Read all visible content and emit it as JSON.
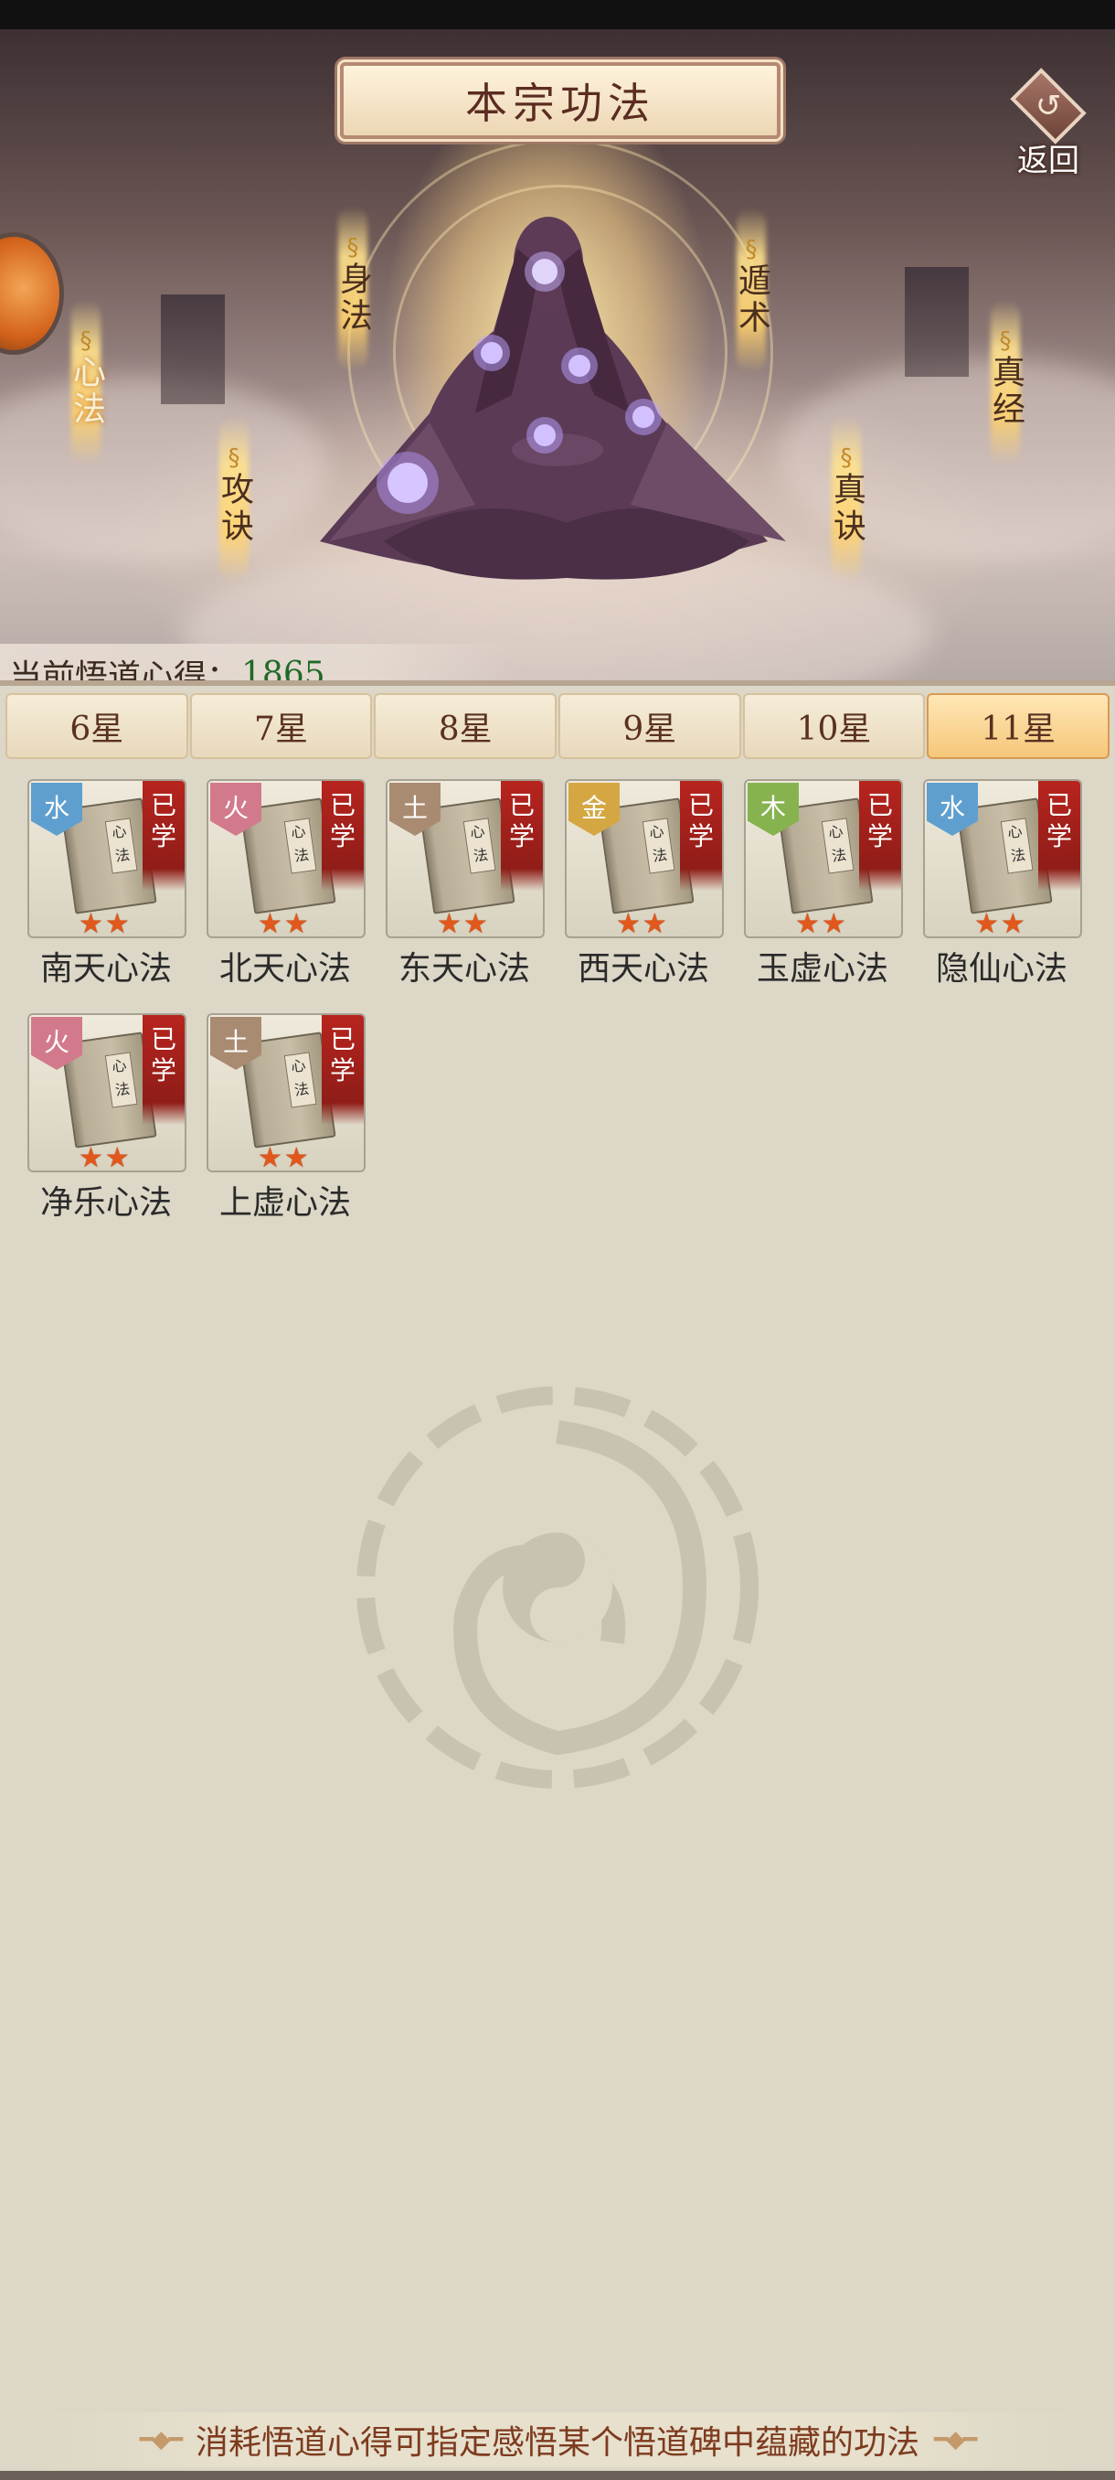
{
  "header": {
    "title": "本宗功法",
    "back_label": "返回"
  },
  "techniques": {
    "xinfa": "心法",
    "shenfa": "身法",
    "gongjue": "攻诀",
    "dunshu": "遁术",
    "zhenjue": "真诀",
    "zhenjing": "真经"
  },
  "wudao": {
    "label": "当前悟道心得：",
    "value": "1865"
  },
  "tabs": [
    {
      "label": "6星"
    },
    {
      "label": "7星"
    },
    {
      "label": "8星"
    },
    {
      "label": "9星"
    },
    {
      "label": "10星"
    },
    {
      "label": "11星"
    }
  ],
  "active_tab_index": 5,
  "book_glyph": "心法",
  "learned_text": [
    "已",
    "学"
  ],
  "items": [
    {
      "name": "南天心法",
      "element": "水",
      "element_color": "#5f9fcf",
      "stars": 2
    },
    {
      "name": "北天心法",
      "element": "火",
      "element_color": "#d27a8c",
      "stars": 2
    },
    {
      "name": "东天心法",
      "element": "土",
      "element_color": "#a98b72",
      "stars": 2
    },
    {
      "name": "西天心法",
      "element": "金",
      "element_color": "#d5a743",
      "stars": 2
    },
    {
      "name": "玉虚心法",
      "element": "木",
      "element_color": "#86b34f",
      "stars": 2
    },
    {
      "name": "隐仙心法",
      "element": "水",
      "element_color": "#5f9fcf",
      "stars": 2
    },
    {
      "name": "净乐心法",
      "element": "火",
      "element_color": "#d27a8c",
      "stars": 2
    },
    {
      "name": "上虚心法",
      "element": "土",
      "element_color": "#a98b72",
      "stars": 2
    }
  ],
  "footer": {
    "text": "消耗悟道心得可指定感悟某个悟道碑中蕴藏的功法"
  }
}
